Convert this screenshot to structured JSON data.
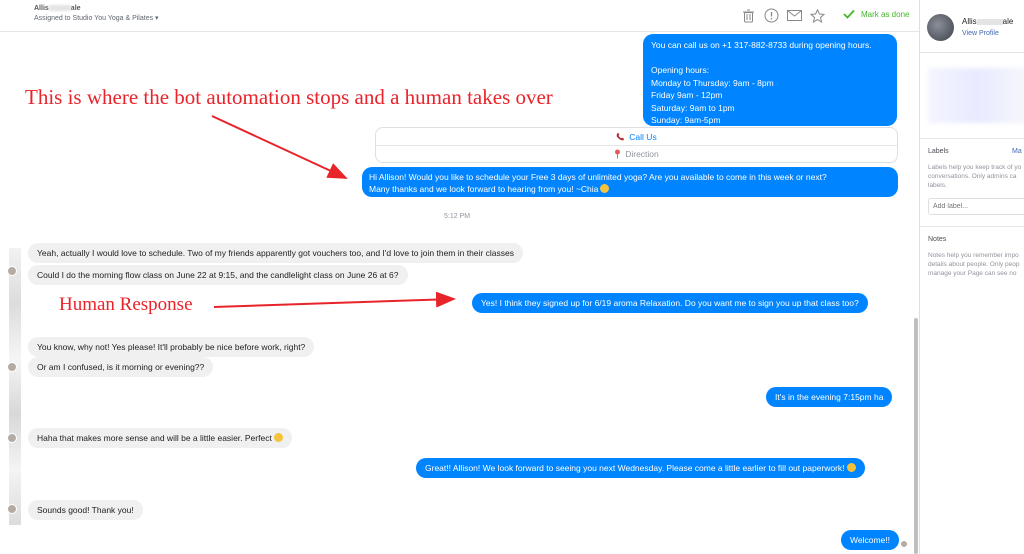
{
  "header": {
    "contact_name_start": "Allis",
    "contact_name_end": "ale",
    "assigned_to": "Assigned to Studio You Yoga & Pilates ▾",
    "mark_done_label": "Mark as done"
  },
  "messages": {
    "hours": [
      "You can call us on +1 317-882-8733 during opening hours.",
      "",
      "Opening hours:",
      "Monday to Thursday: 9am - 8pm",
      "Friday 9am - 12pm",
      "Saturday: 9am to 1pm",
      "Sunday: 9am-5pm"
    ],
    "call_us_label": "Call Us",
    "direction_label": "Direction",
    "schedule_line1": "Hi Allison! Would you like to schedule your Free 3 days of unlimited yoga? Are you available to come in this week or next?",
    "schedule_line2": "Many thanks and we look forward to hearing from you! ~Chia",
    "timestamp": "5:12 PM",
    "in_1": "Yeah, actually I would love to schedule. Two of my friends apparently got vouchers too, and I'd love to join them in their classes",
    "in_2": "Could I do the morning flow class on June 22 at 9:15, and the candlelight class on June 26 at 6?",
    "out_1": "Yes! I think they signed up for 6/19 aroma Relaxation. Do you want me to sign you up that class too?",
    "in_3": "You know, why not! Yes please! It'll probably be nice before work, right?",
    "in_4": "Or am I confused, is it morning or evening??",
    "out_2": "It's in the evening 7:15pm ha",
    "in_5": "Haha that makes more sense and will be a little easier. Perfect",
    "out_3": "Great!! Allison! We look forward to seeing you next Wednesday. Please come a little earlier to fill out paperwork!",
    "in_6": "Sounds good! Thank you!",
    "out_4": "Welcome!!"
  },
  "annotations": {
    "bot_stop": "This is where the bot automation stops and a human takes over",
    "human_response": "Human Response"
  },
  "panel": {
    "name_start": "Allis",
    "name_end": "ale",
    "view_profile": "View Profile",
    "labels_title": "Labels",
    "manage_label": "Ma",
    "labels_help": [
      "Labels help you keep track of yo",
      "conversations. Only admins ca",
      "labels."
    ],
    "add_label_placeholder": "Add label...",
    "notes_title": "Notes",
    "notes_help": [
      "Notes help you remember impo",
      "details about people. Only peop",
      "manage your Page can see no"
    ]
  },
  "colors": {
    "outgoing": "#0084ff",
    "incoming": "#f1f0f0",
    "annotation": "#e8232a",
    "done": "#42b72a"
  },
  "icons": [
    "trash-icon",
    "spam-icon",
    "mail-icon",
    "star-icon",
    "check-icon",
    "phone-icon",
    "pin-icon",
    "smiley-icon"
  ]
}
